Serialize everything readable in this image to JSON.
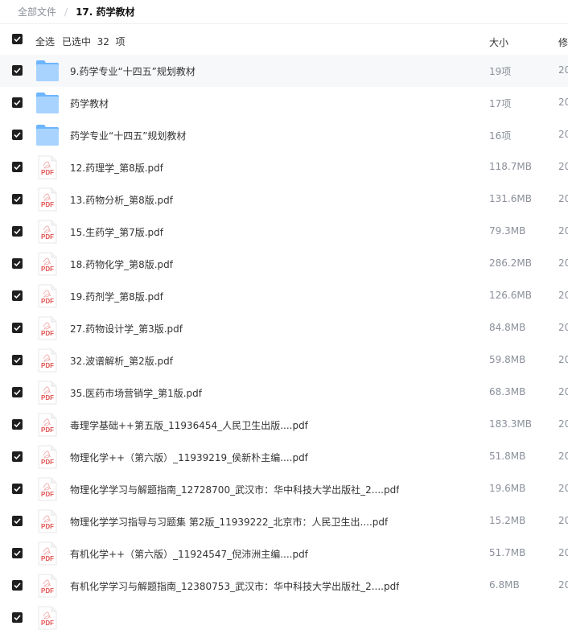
{
  "breadcrumb": {
    "root": "全部文件",
    "separator": "/",
    "current": "17. 药学教材"
  },
  "header": {
    "select_all": "全选",
    "selected_text": "已选中  32  项",
    "col_size": "大小",
    "col_modified": "修"
  },
  "rows": [
    {
      "type": "folder",
      "name": "9.药学专业“十四五”规划教材",
      "size": "19项",
      "mod": "20"
    },
    {
      "type": "folder",
      "name": "药学教材",
      "size": "17项",
      "mod": "20"
    },
    {
      "type": "folder",
      "name": "药学专业“十四五”规划教材",
      "size": "16项",
      "mod": "20"
    },
    {
      "type": "pdf",
      "name": "12.药理学_第8版.pdf",
      "size": "118.7MB",
      "mod": "20"
    },
    {
      "type": "pdf",
      "name": "13.药物分析_第8版.pdf",
      "size": "131.6MB",
      "mod": "20"
    },
    {
      "type": "pdf",
      "name": "15.生药学_第7版.pdf",
      "size": "79.3MB",
      "mod": "20"
    },
    {
      "type": "pdf",
      "name": "18.药物化学_第8版.pdf",
      "size": "286.2MB",
      "mod": "20"
    },
    {
      "type": "pdf",
      "name": "19.药剂学_第8版.pdf",
      "size": "126.6MB",
      "mod": "20"
    },
    {
      "type": "pdf",
      "name": "27.药物设计学_第3版.pdf",
      "size": "84.8MB",
      "mod": "20"
    },
    {
      "type": "pdf",
      "name": "32.波谱解析_第2版.pdf",
      "size": "59.8MB",
      "mod": "20"
    },
    {
      "type": "pdf",
      "name": "35.医药市场营销学_第1版.pdf",
      "size": "68.3MB",
      "mod": "20"
    },
    {
      "type": "pdf",
      "name": "毒理学基础++第五版_11936454_人民卫生出版....pdf",
      "size": "183.3MB",
      "mod": "20"
    },
    {
      "type": "pdf",
      "name": "物理化学++（第六版）_11939219_侯新朴主编....pdf",
      "size": "51.8MB",
      "mod": "20"
    },
    {
      "type": "pdf",
      "name": "物理化学学习与解题指南_12728700_武汉市：华中科技大学出版社_2....pdf",
      "size": "19.6MB",
      "mod": "20"
    },
    {
      "type": "pdf",
      "name": "物理化学学习指导与习题集 第2版_11939222_北京市：人民卫生出....pdf",
      "size": "15.2MB",
      "mod": "20"
    },
    {
      "type": "pdf",
      "name": "有机化学++（第六版）_11924547_倪沛洲主编....pdf",
      "size": "51.7MB",
      "mod": "20"
    },
    {
      "type": "pdf",
      "name": "有机化学学习与解题指南_12380753_武汉市：华中科技大学出版社_2....pdf",
      "size": "6.8MB",
      "mod": "20"
    },
    {
      "type": "pdf",
      "name": "",
      "size": "",
      "mod": ""
    }
  ],
  "icons": {
    "folder": "folder-icon",
    "pdf": "pdf-file-icon",
    "checkbox": "checkbox-checked-icon"
  },
  "colors": {
    "folder_light": "#a9d3ff",
    "folder_dark": "#6cb5ff",
    "pdf_red": "#e55353",
    "checkbox": "#1f1f1f"
  }
}
